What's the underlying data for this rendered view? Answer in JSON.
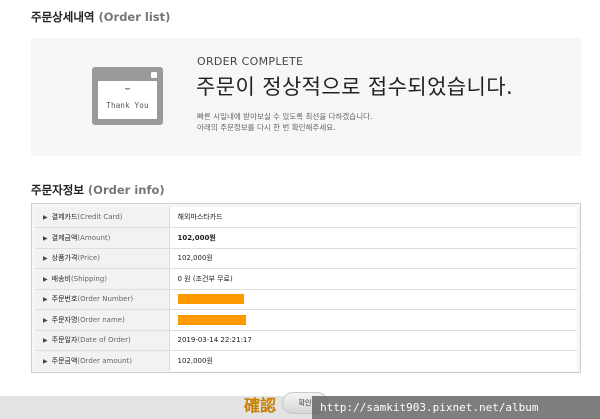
{
  "order_list": {
    "title_ko": "주문상세내역",
    "title_en": "(Order list)"
  },
  "complete": {
    "icon_smile": "⌣",
    "icon_text": "Thank You",
    "label": "ORDER COMPLETE",
    "headline": "주문이 정상적으로 접수되었습니다.",
    "desc_line1": "빠른 시일내에 받아보실 수 있도록 최선을 다하겠습니다.",
    "desc_line2": "아래의 주문정보를 다시 한 번 확인해주세요."
  },
  "order_info": {
    "title_ko": "주문자정보",
    "title_en": "(Order info)",
    "rows": [
      {
        "label_ko": "결제카드",
        "label_en": "(Credit Card)",
        "value": "해외마스타카드"
      },
      {
        "label_ko": "결제금액",
        "label_en": "(Amount)",
        "value": "102,000원"
      },
      {
        "label_ko": "상품가격",
        "label_en": "(Price)",
        "value": "102,000원"
      },
      {
        "label_ko": "배송비",
        "label_en": "(Shipping)",
        "value": "0 원 (조건부 무료)"
      },
      {
        "label_ko": "주문번호",
        "label_en": "(Order Number)",
        "value": ""
      },
      {
        "label_ko": "주문자명",
        "label_en": "(Order name)",
        "value": ""
      },
      {
        "label_ko": "주문일자",
        "label_en": "(Date of Order)",
        "value": "2019-03-14 22:21:17"
      },
      {
        "label_ko": "주문금액",
        "label_en": "(Order amount)",
        "value": "102,000원"
      }
    ]
  },
  "footer": {
    "confirm_zh": "確認",
    "confirm_button": "확인",
    "watermark": "http://samkit903.pixnet.net/album"
  },
  "colors": {
    "redaction": "#ff9900",
    "confirm_zh": "#c77f00"
  }
}
